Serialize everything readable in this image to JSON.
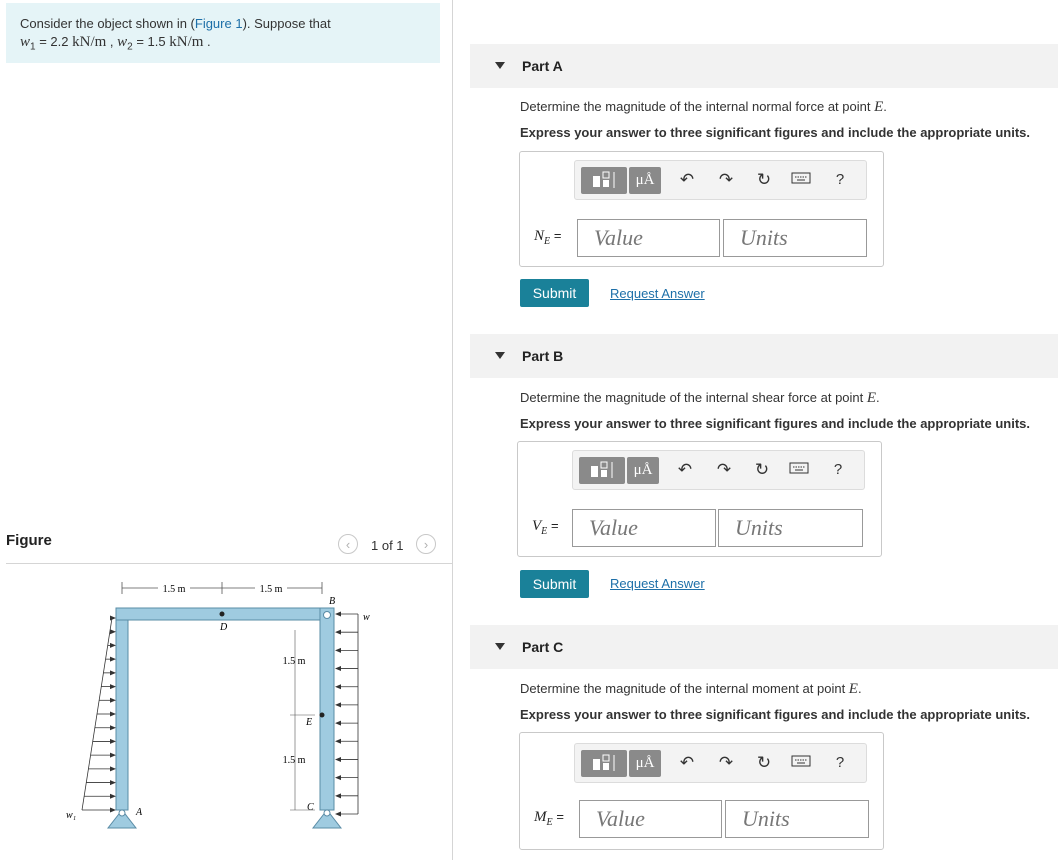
{
  "problem": {
    "line1_prefix": "Consider the object shown in (",
    "line1_link": "Figure 1",
    "line1_suffix": "). Suppose that",
    "w1_label": "w",
    "w1_sub": "1",
    "w1_value": "= 2.2",
    "w1_units": "kN/m",
    "w2_label": "w",
    "w2_sub": "2",
    "w2_value": "= 1.5",
    "w2_units": "kN/m"
  },
  "figure": {
    "title": "Figure",
    "pager": "1 of 1",
    "prev_icon": "chevron-left-icon",
    "next_icon": "chevron-right-icon",
    "dims": {
      "top_left": "1.5 m",
      "top_right": "1.5 m",
      "right_upper": "1.5 m",
      "right_lower": "1.5 m"
    },
    "points": {
      "A": "A",
      "B": "B",
      "C": "C",
      "D": "D",
      "E": "E"
    },
    "loads": {
      "w1": "w₁",
      "w2": "w₂"
    }
  },
  "parts": [
    {
      "title": "Part A",
      "question_prefix": "Determine the magnitude of the internal normal force at point ",
      "question_point": "E",
      "instruction": "Express your answer to three significant figures and include the appropriate units.",
      "var": "N",
      "var_sub": "E",
      "value_placeholder": "Value",
      "units_placeholder": "Units",
      "submit": "Submit",
      "request": "Request Answer"
    },
    {
      "title": "Part B",
      "question_prefix": "Determine the magnitude of the internal shear force at point ",
      "question_point": "E",
      "instruction": "Express your answer to three significant figures and include the appropriate units.",
      "var": "V",
      "var_sub": "E",
      "value_placeholder": "Value",
      "units_placeholder": "Units",
      "submit": "Submit",
      "request": "Request Answer"
    },
    {
      "title": "Part C",
      "question_prefix": "Determine the magnitude of the internal moment at point ",
      "question_point": "E",
      "instruction": "Express your answer to three significant figures and include the appropriate units.",
      "var": "M",
      "var_sub": "E",
      "value_placeholder": "Value",
      "units_placeholder": "Units"
    }
  ],
  "toolbar": {
    "mu_label": "μÅ",
    "undo_icon": "undo-icon",
    "redo_icon": "redo-icon",
    "reset_icon": "reset-icon",
    "keyboard_icon": "keyboard-icon",
    "help_label": "?"
  }
}
